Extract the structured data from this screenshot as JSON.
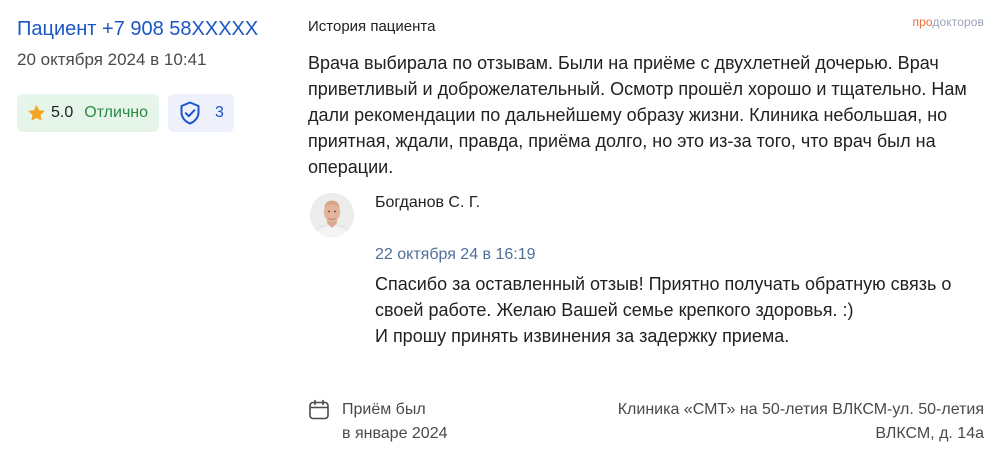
{
  "author": {
    "name": "Пациент +7 908 58XXXXX",
    "date": "20 октября 2024 в 10:41"
  },
  "rating": {
    "value": "5.0",
    "label": "Отлично",
    "icon": "star-icon",
    "color": "#f5a623"
  },
  "verified": {
    "count": "3",
    "icon": "shield-check-icon"
  },
  "logo": {
    "accent": "про",
    "rest": "докторов"
  },
  "review": {
    "section_title": "История пациента",
    "text": "Врача выбирала по отзывам. Были на приёме с двухлетней дочерью. Врач приветливый и доброжелательный. Осмотр прошёл хорошо и тщательно. Нам дали рекомендации по дальнейшему образу жизни. Клиника небольшая, но приятная, ждали, правда, приёма долго, но это из-за того, что врач был на операции."
  },
  "reply": {
    "author": "Богданов С. Г.",
    "date": "22 октября 24 в 16:19",
    "line1": "Спасибо за оставленный отзыв! Приятно получать обратную связь о своей работе. Желаю Вашей семье крепкого здоровья. :)",
    "line2": "И прошу принять извинения за задержку приема."
  },
  "visit": {
    "line1": "Приём был",
    "line2": "в январе 2024",
    "icon": "calendar-icon"
  },
  "clinic": {
    "line1": "Клиника «СМТ» на 50-летия ВЛКСМ-ул. 50-летия",
    "line2": "ВЛКСМ, д. 14а"
  },
  "colors": {
    "link": "#1a56c7",
    "success": "#2a8a43",
    "success_bg": "#e6f5ea",
    "reply_date": "#4f6f9a",
    "logo_accent": "#f06a3c"
  }
}
